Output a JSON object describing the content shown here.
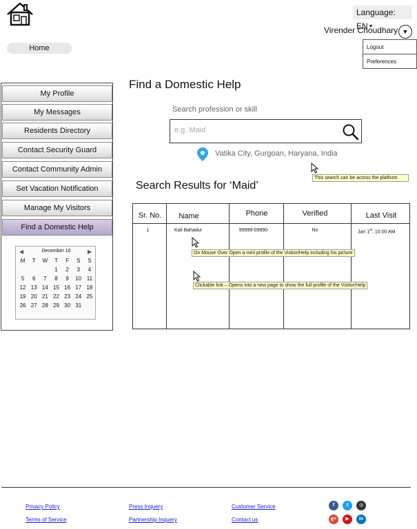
{
  "header": {
    "language": "Language: EN",
    "user_name": "Virender Choudhary",
    "user_menu": [
      "Logout",
      "Preferences"
    ],
    "home_tab": "Home"
  },
  "sidebar": {
    "items": [
      {
        "label": "My Profile"
      },
      {
        "label": "My Messages"
      },
      {
        "label": "Residents Directory"
      },
      {
        "label": "Contact Security Guard"
      },
      {
        "label": "Contact Community Admin"
      },
      {
        "label": "Set Vacation Notification"
      },
      {
        "label": "Manage My Visitors"
      },
      {
        "label": "Find a Domestic Help",
        "active": true
      }
    ],
    "calendar": {
      "title": "December 16",
      "weekdays": [
        "M",
        "T",
        "W",
        "T",
        "F",
        "S",
        "S"
      ],
      "weeks": [
        [
          "",
          "",
          "",
          "1",
          "2",
          "3",
          "4"
        ],
        [
          "5",
          "6",
          "7",
          "8",
          "9",
          "10",
          "11"
        ],
        [
          "12",
          "13",
          "14",
          "15",
          "16",
          "17",
          "18"
        ],
        [
          "19",
          "20",
          "21",
          "22",
          "23",
          "24",
          "25"
        ],
        [
          "26",
          "27",
          "28",
          "29",
          "30",
          "31",
          ""
        ]
      ]
    }
  },
  "main": {
    "title": "Find a Domestic Help",
    "search_label": "Search  profession or skill",
    "search_placeholder": "e.g. Maid",
    "location": "Vatika City, Gurgoan, Haryana, India",
    "platform_note": "This search can be across the platform",
    "results_title": "Search Results for ‘Maid’",
    "columns": [
      "Sr. No.",
      "Name",
      "Phone",
      "Verified",
      "Last Visit"
    ],
    "rows": [
      {
        "sr": "1",
        "name": "Kali Bahadur",
        "phone": "99999-09890",
        "verified": "No",
        "last_visit_day": "Jan 1",
        "last_visit_sup": "st",
        "last_visit_time": ", 10:00 AM"
      }
    ],
    "mouseover_note": "On Mouse Over Open a mini profile of the Vistior/Help including his picture",
    "click_note": "Clickable link – Opens into a new page to show the full profile of the Visitor/Help"
  },
  "footer": {
    "links": [
      "Privacy Policy",
      "Terms of Service",
      "Press Inquery",
      "Partnership Inquery",
      "Customer Service",
      "Contact us"
    ],
    "social_icons": [
      {
        "name": "facebook",
        "color": "#3b5998"
      },
      {
        "name": "twitter",
        "color": "#1da1f2"
      },
      {
        "name": "instagram",
        "color": "#333333"
      },
      {
        "name": "google-plus",
        "color": "#dd4b39"
      },
      {
        "name": "youtube",
        "color": "#cc181e"
      },
      {
        "name": "linkedin",
        "color": "#0077b5"
      }
    ]
  }
}
